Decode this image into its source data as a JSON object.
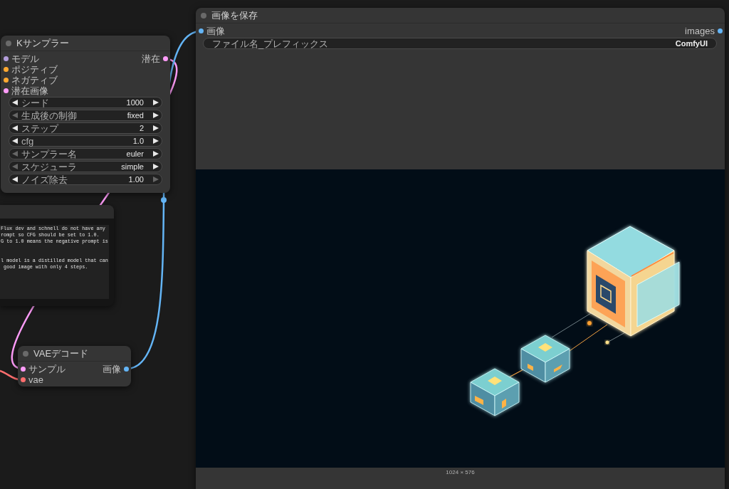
{
  "sampler_node": {
    "title": "Kサンプラー",
    "inputs": [
      {
        "label": "モデル",
        "color": "#b39ddb"
      },
      {
        "label": "ポジティブ",
        "color": "#ffa931"
      },
      {
        "label": "ネガティブ",
        "color": "#ffa931"
      },
      {
        "label": "潜在画像",
        "color": "#ff9cf9"
      }
    ],
    "outputs": [
      {
        "label": "潜在",
        "color": "#ff9cf9"
      }
    ],
    "widgets": [
      {
        "kind": "stepper",
        "label": "シード",
        "value": "1000",
        "decrement_enabled": true,
        "increment_enabled": true
      },
      {
        "kind": "stepper",
        "label": "生成後の制御",
        "value": "fixed",
        "decrement_enabled": false,
        "increment_enabled": true
      },
      {
        "kind": "stepper",
        "label": "ステップ",
        "value": "2",
        "decrement_enabled": true,
        "increment_enabled": true
      },
      {
        "kind": "stepper",
        "label": "cfg",
        "value": "1.0",
        "decrement_enabled": true,
        "increment_enabled": true
      },
      {
        "kind": "stepper",
        "label": "サンプラー名",
        "value": "euler",
        "decrement_enabled": false,
        "increment_enabled": true
      },
      {
        "kind": "stepper",
        "label": "スケジューラ",
        "value": "simple",
        "decrement_enabled": false,
        "increment_enabled": true
      },
      {
        "kind": "stepper",
        "label": "ノイズ除去",
        "value": "1.00",
        "decrement_enabled": true,
        "increment_enabled": false
      }
    ]
  },
  "note_node": {
    "paragraphs": [
      "Flux dev and schnell do not have any\nrompt so CFG should be set to 1.0.\nG to 1.0 means the negative prompt is",
      "l model is a distilled model that can\n good image with only 4 steps."
    ]
  },
  "vae_decode_node": {
    "title": "VAEデコード",
    "inputs": [
      {
        "label": "サンプル",
        "color": "#ff9cf9"
      },
      {
        "label": "vae",
        "color": "#ff6e6e"
      }
    ],
    "outputs": [
      {
        "label": "画像",
        "color": "#64b5f6"
      }
    ]
  },
  "save_image_node": {
    "title": "画像を保存",
    "inputs": [
      {
        "label": "画像",
        "color": "#64b5f6"
      }
    ],
    "outputs": [
      {
        "label": "images",
        "color": "#64b5f6"
      }
    ],
    "widgets": [
      {
        "kind": "text",
        "label": "ファイル名_プレフィックス",
        "value": "ComfyUI"
      }
    ],
    "image_size": "1024 × 576"
  }
}
